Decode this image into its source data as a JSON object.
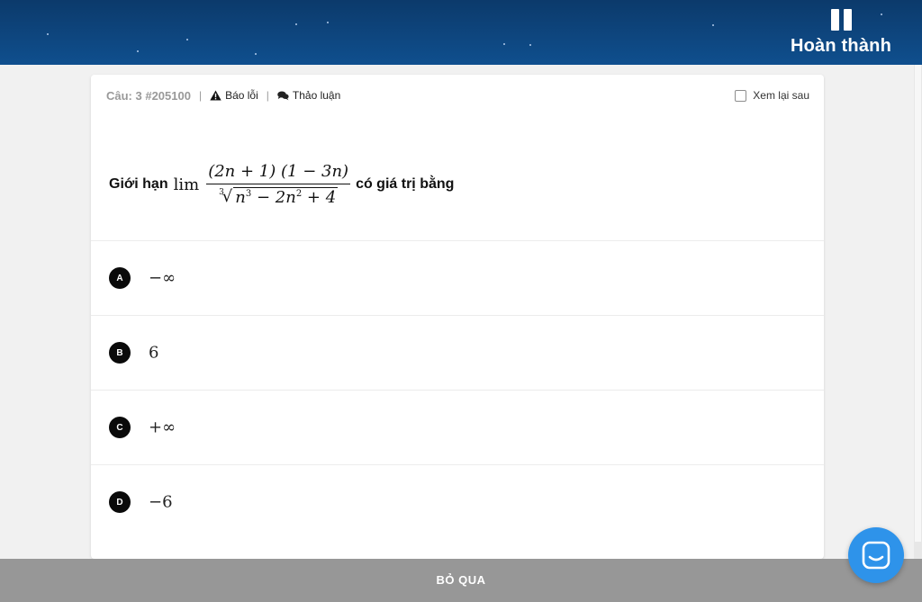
{
  "header": {
    "finish_label": "Hoàn thành",
    "pause_icon": "pause-icon"
  },
  "question": {
    "number_label": "Câu: 3 #205100",
    "report_label": "Báo lỗi",
    "report_icon": "warning-icon",
    "discuss_label": "Thảo luận",
    "discuss_icon": "chat-bubbles-icon",
    "review_label": "Xem lại sau",
    "review_checked": false,
    "prefix": "Giới hạn",
    "lim": "lim",
    "numerator": "(2n + 1) (1 − 3n)",
    "root_index": "3",
    "radicand_parts": [
      "n",
      "3",
      " − 2n",
      "2",
      " + 4"
    ],
    "suffix": "có giá trị bằng"
  },
  "options": [
    {
      "letter": "A",
      "value": "−∞"
    },
    {
      "letter": "B",
      "value": "6"
    },
    {
      "letter": "C",
      "value": "+∞"
    },
    {
      "letter": "D",
      "value": "−6"
    }
  ],
  "footer": {
    "skip_label": "BỎ QUA"
  },
  "chat": {
    "icon": "chat-icon",
    "color": "#2e93ea"
  },
  "colors": {
    "topbar": "#0f4f8e",
    "footer": "#979797",
    "badge": "#0a0a0a"
  }
}
